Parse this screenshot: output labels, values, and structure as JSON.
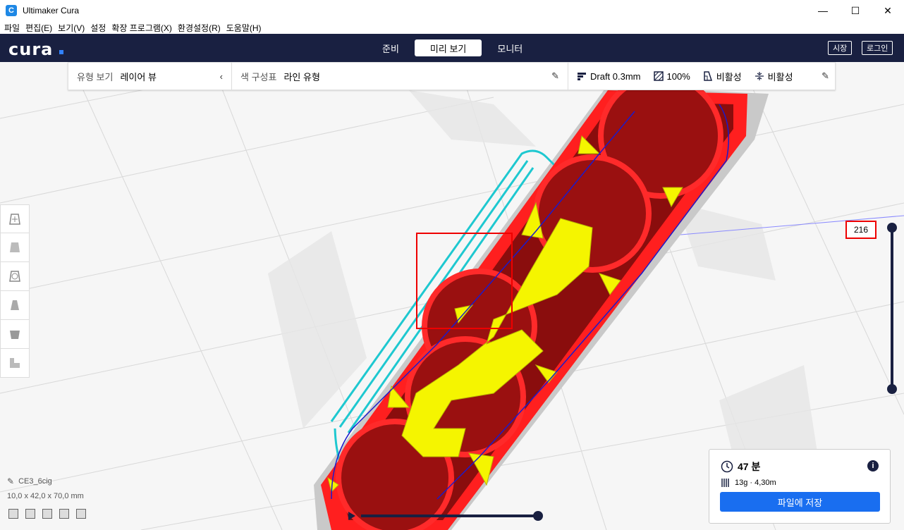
{
  "window": {
    "title": "Ultimaker Cura",
    "app_icon_glyph": "C",
    "minimize_glyph": "—",
    "maximize_glyph": "☐",
    "close_glyph": "✕"
  },
  "menu": [
    "파일",
    "편집(E)",
    "보기(V)",
    "설정",
    "확장 프로그램(X)",
    "환경설정(R)",
    "도움말(H)"
  ],
  "header": {
    "logo": "cura",
    "tabs": [
      {
        "label": "준비",
        "active": false
      },
      {
        "label": "미리 보기",
        "active": true
      },
      {
        "label": "모니터",
        "active": false
      }
    ],
    "market_button": "시장",
    "login_button": "로그인"
  },
  "view_toolbar": {
    "view_type_label": "유형 보기",
    "view_type_value": "레이어 뷰",
    "color_scheme_label": "색 구성표",
    "color_scheme_value": "라인 유형",
    "profile": "Draft 0.3mm",
    "infill": "100%",
    "support": "비활성",
    "adhesion": "비활성"
  },
  "layer_slider": {
    "value": "216"
  },
  "object": {
    "name": "CE3_6cig",
    "dimensions": "10,0 x 42,0 x 70,0 mm"
  },
  "print_panel": {
    "time": "47 분",
    "material": "13g · 4,30m",
    "save_button": "파일에 저장"
  },
  "colors": {
    "header_bg": "#192041",
    "accent": "#196ef0",
    "wall": "#ff2020",
    "infill": "#ffff00",
    "skirt": "#00d4d4"
  }
}
